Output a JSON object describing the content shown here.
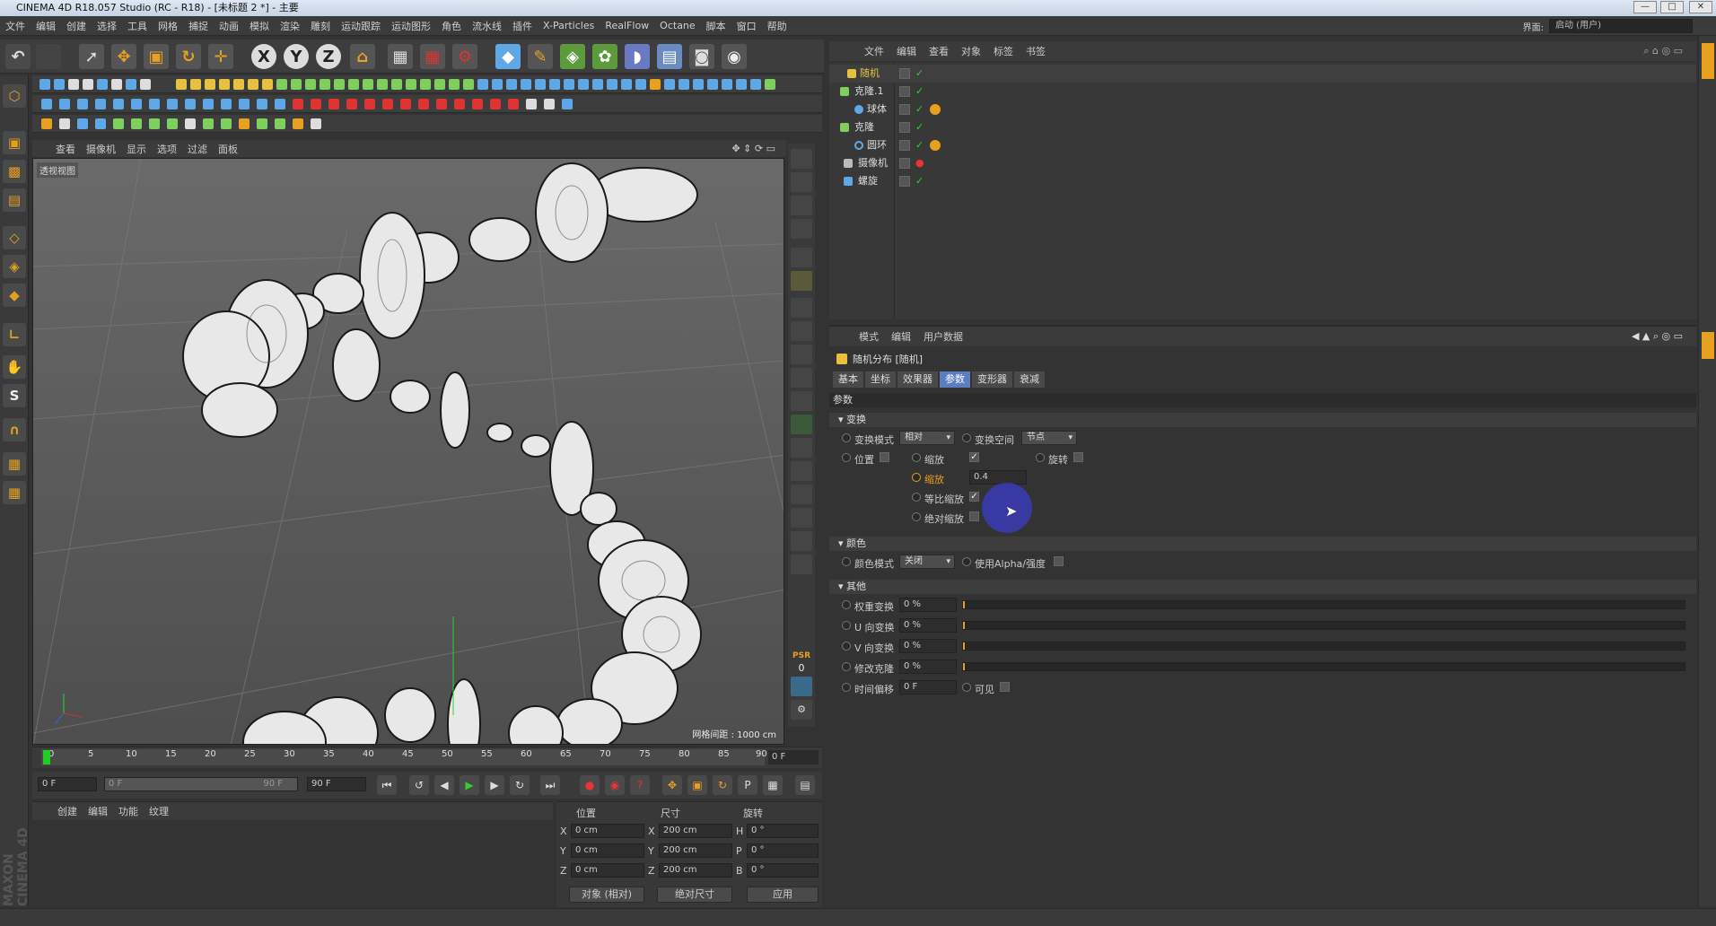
{
  "window": {
    "title": "CINEMA 4D R18.057 Studio (RC - R18) - [未标题 2 *] - 主要",
    "min": "—",
    "max": "□",
    "close": "✕"
  },
  "menubar": [
    "文件",
    "编辑",
    "创建",
    "选择",
    "工具",
    "网格",
    "捕捉",
    "动画",
    "模拟",
    "渲染",
    "雕刻",
    "运动跟踪",
    "运动图形",
    "角色",
    "流水线",
    "插件",
    "X-Particles",
    "RealFlow",
    "Octane",
    "脚本",
    "窗口",
    "帮助"
  ],
  "layout": {
    "label": "界面:",
    "value": "启动 (用户)"
  },
  "viewport": {
    "menu": [
      "查看",
      "摄像机",
      "显示",
      "选项",
      "过滤",
      "面板"
    ],
    "label": "透视视图",
    "grid_label": "网格间距 : 1000 cm"
  },
  "timeline": {
    "ticks": [
      "0",
      "5",
      "10",
      "15",
      "20",
      "25",
      "30",
      "35",
      "40",
      "45",
      "50",
      "55",
      "60",
      "65",
      "70",
      "75",
      "80",
      "85",
      "90"
    ],
    "current_frame": "0 F"
  },
  "transport": {
    "start": "0 F",
    "range_start": "0 F",
    "range_end": "90 F",
    "end": "90 F"
  },
  "material": {
    "menu": [
      "创建",
      "编辑",
      "功能",
      "纹理"
    ]
  },
  "coords": {
    "headers": {
      "pos": "位置",
      "size": "尺寸",
      "rot": "旋转"
    },
    "rows": [
      {
        "axis": "X",
        "pos": "0 cm",
        "saxis": "X",
        "size": "200 cm",
        "raxis": "H",
        "rot": "0 °"
      },
      {
        "axis": "Y",
        "pos": "0 cm",
        "saxis": "Y",
        "size": "200 cm",
        "raxis": "P",
        "rot": "0 °"
      },
      {
        "axis": "Z",
        "pos": "0 cm",
        "saxis": "Z",
        "size": "200 cm",
        "raxis": "B",
        "rot": "0 °"
      }
    ],
    "mode": "对象 (相对)",
    "size_mode": "绝对尺寸",
    "apply": "应用"
  },
  "objects": {
    "menu": [
      "文件",
      "编辑",
      "查看",
      "对象",
      "标签",
      "书签"
    ],
    "items": [
      {
        "name": "随机",
        "color": "#e8c040",
        "active": true
      },
      {
        "name": "克隆.1",
        "color": "#7fcf5f"
      },
      {
        "name": "球体",
        "color": "#5fa8e8"
      },
      {
        "name": "克隆",
        "color": "#7fcf5f"
      },
      {
        "name": "圆环",
        "color": "#5fa8e8"
      },
      {
        "name": "摄像机",
        "color": "#bbbbbb"
      },
      {
        "name": "螺旋",
        "color": "#5fa8e8"
      }
    ]
  },
  "attributes": {
    "menu": [
      "模式",
      "编辑",
      "用户数据"
    ],
    "title": "随机分布 [随机]",
    "tabs": [
      "基本",
      "坐标",
      "效果器",
      "参数",
      "变形器",
      "衰减"
    ],
    "section_params": "参数",
    "sec_transform": "▾ 变换",
    "transform_mode_label": "变换模式",
    "transform_mode_value": "相对",
    "transform_space_label": "变换空间",
    "transform_space_value": "节点",
    "position_label": "位置",
    "scale_label": "缩放",
    "rotation_label": "旋转",
    "scale_value_label": "缩放",
    "scale_value": "0.4",
    "uniform_scale_label": "等比缩放",
    "abs_scale_label": "绝对缩放",
    "sec_color": "▾ 颜色",
    "color_mode_label": "颜色模式",
    "color_mode_value": "关闭",
    "use_alpha_label": "使用Alpha/强度",
    "sec_other": "▾ 其他",
    "weight_label": "权重变换",
    "weight_value": "0 %",
    "u_label": "U 向变换",
    "u_value": "0 %",
    "v_label": "V 向变换",
    "v_value": "0 %",
    "modify_label": "修改克隆",
    "modify_value": "0 %",
    "time_label": "时间偏移",
    "time_value": "0 F",
    "visible_label": "可见"
  },
  "icons": {
    "undo": "↶",
    "axis_x": "X",
    "axis_y": "Y",
    "axis_z": "Z",
    "psr": "PSR",
    "psr_value": "0",
    "check": "✓"
  },
  "colors": {
    "accent": "#5b7ec2",
    "orange": "#e8a020",
    "panel": "#333333"
  }
}
